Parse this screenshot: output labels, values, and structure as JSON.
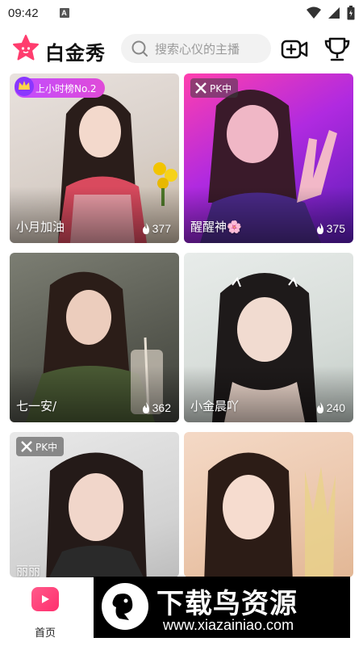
{
  "status_bar": {
    "time": "09:42",
    "notif_letter": "A"
  },
  "header": {
    "app_title": "白金秀",
    "search_placeholder": "搜索心仪的主播"
  },
  "cards": [
    {
      "name": "小月加油",
      "count": "377",
      "badge": "上小时榜No.2",
      "badge_type": "rank"
    },
    {
      "name": "醒醒神🌸",
      "count": "375",
      "badge": "PK中",
      "badge_type": "pk"
    },
    {
      "name": "七一安/",
      "count": "362",
      "badge": "",
      "badge_type": ""
    },
    {
      "name": "小金晨吖",
      "count": "240",
      "badge": "",
      "badge_type": ""
    },
    {
      "name": "丽丽",
      "count": "",
      "badge": "PK中",
      "badge_type": "pk"
    },
    {
      "name": "",
      "count": "",
      "badge": "",
      "badge_type": ""
    }
  ],
  "bottom_nav": {
    "home_label": "首页"
  },
  "watermark": {
    "title": "下载鸟资源",
    "url": "www.xiazainiao.com"
  },
  "colors": {
    "accent": "#ff2f6e",
    "rank_badge": "#c94cff"
  }
}
